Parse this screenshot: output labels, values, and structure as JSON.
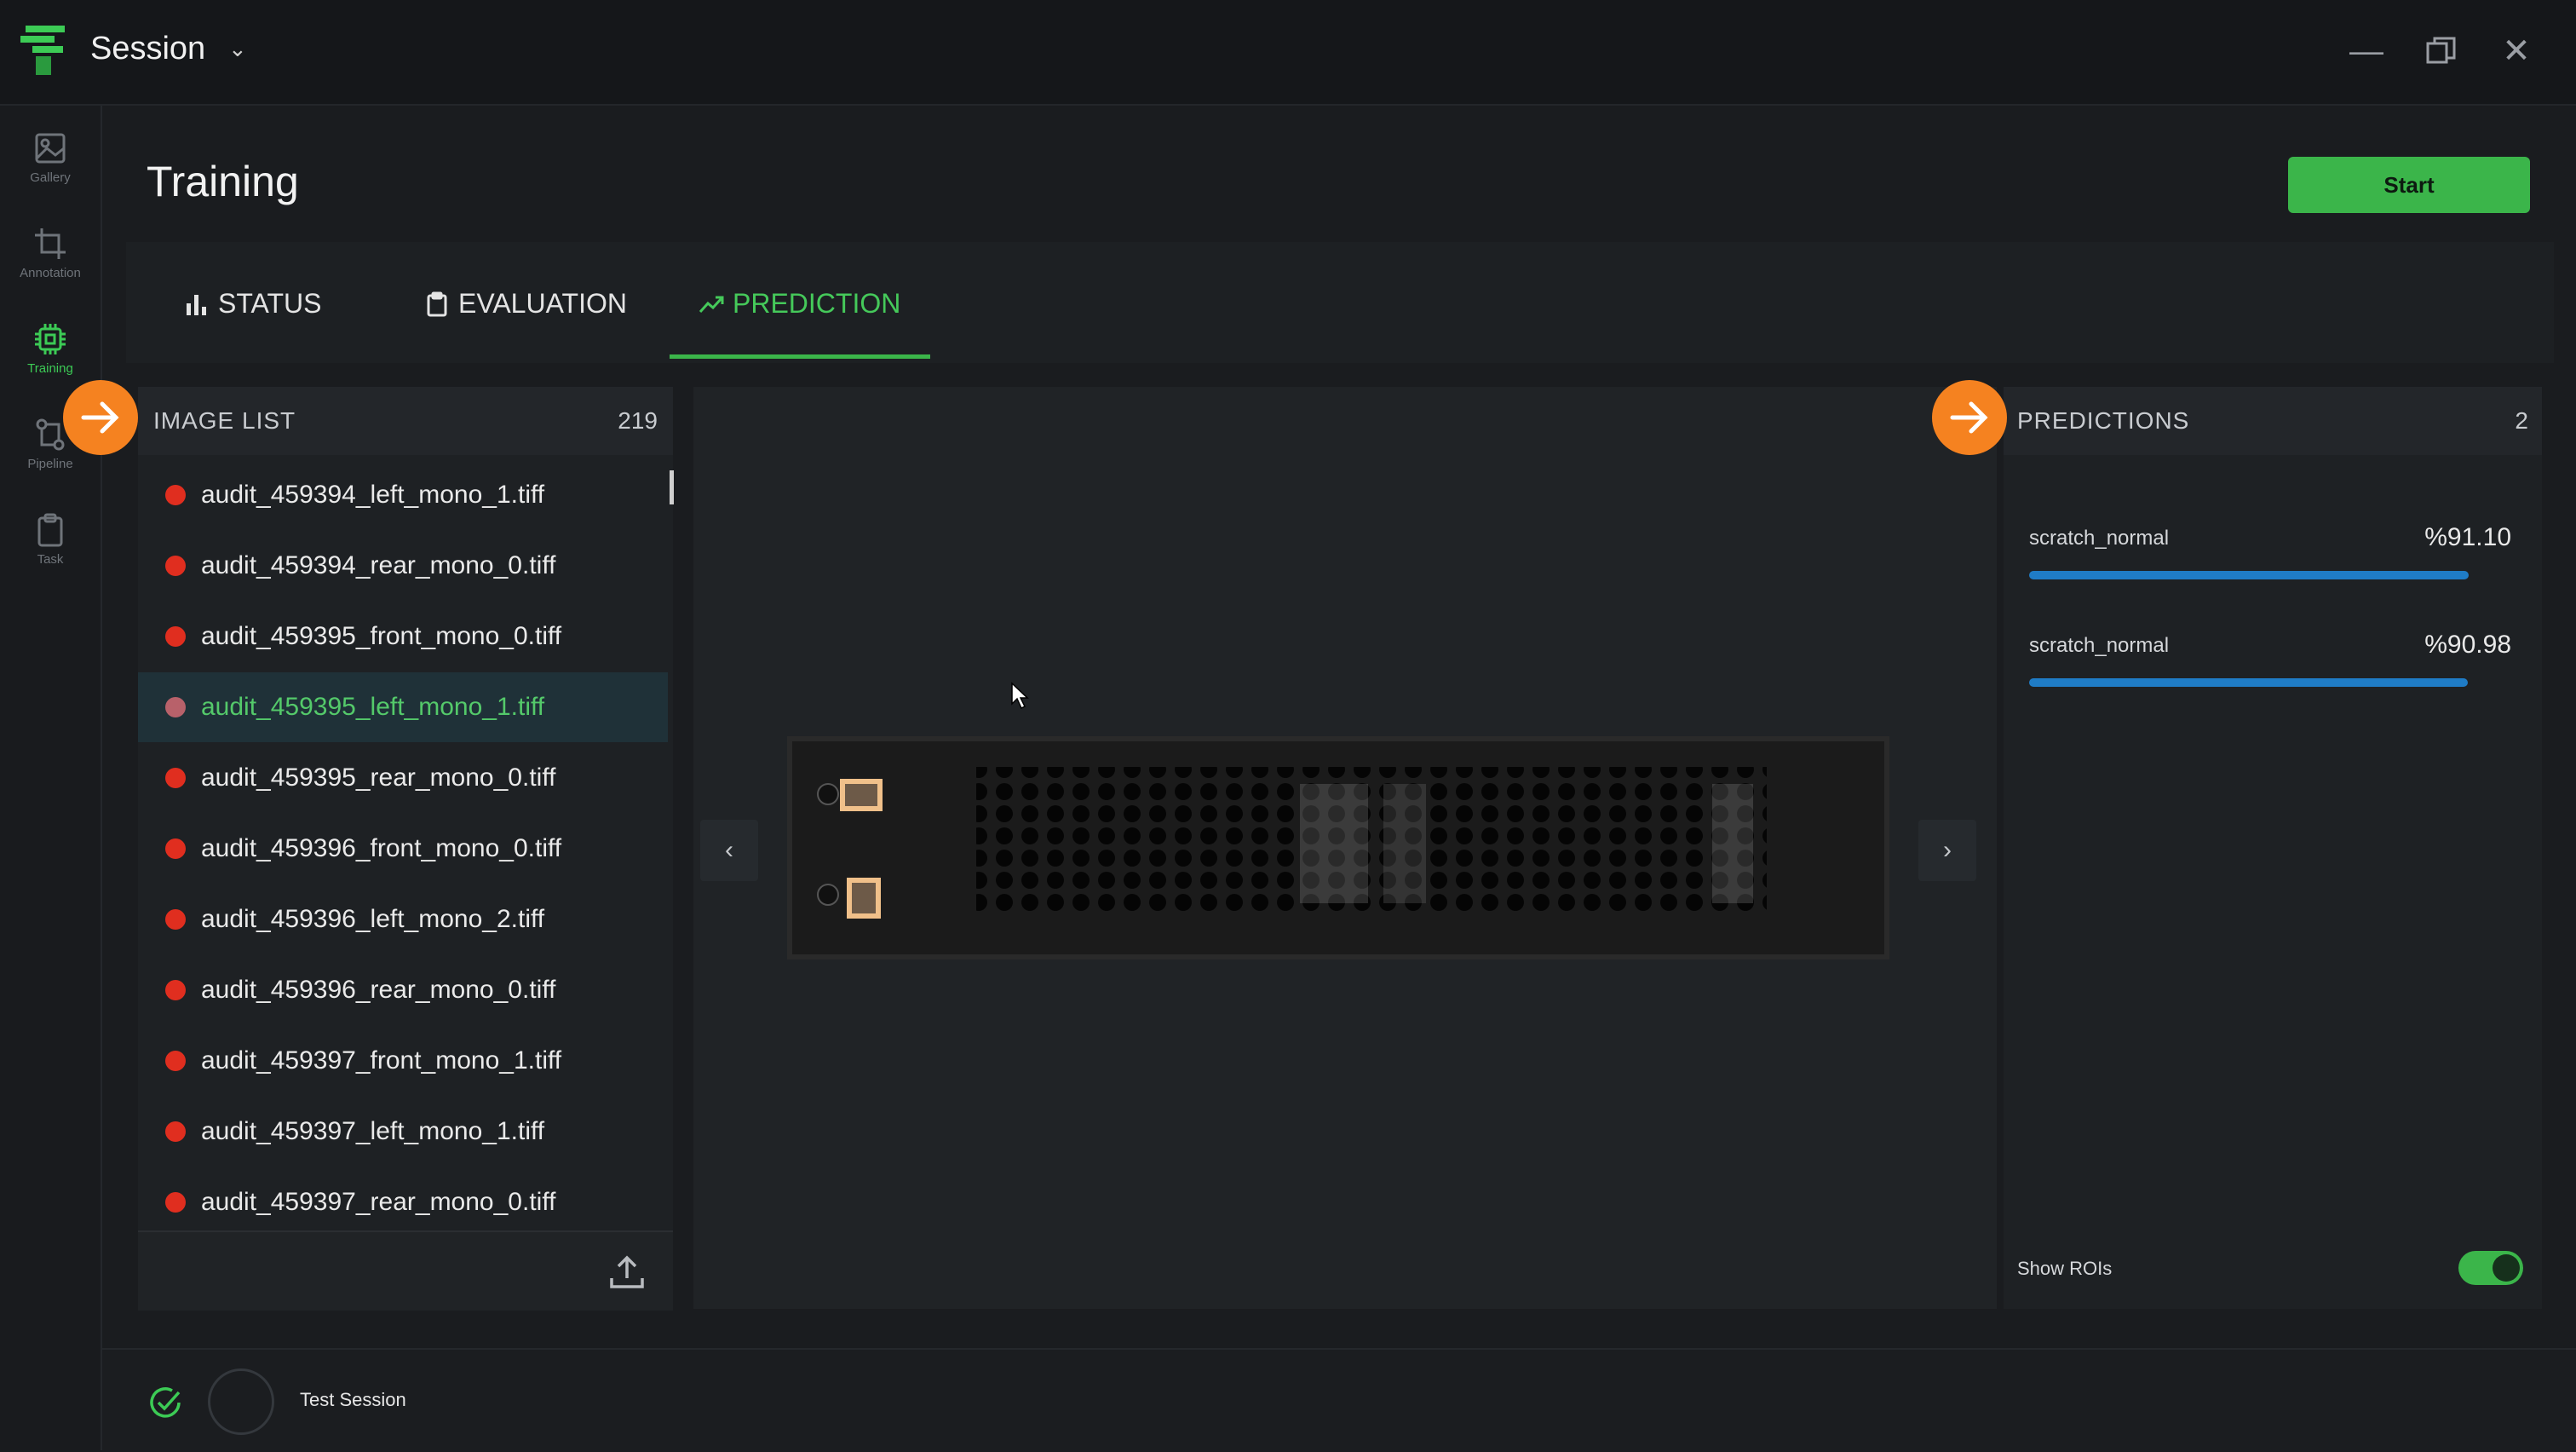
{
  "window": {
    "title": "Session"
  },
  "sidebar": {
    "items": [
      {
        "label": "Gallery",
        "icon": "image-icon"
      },
      {
        "label": "Annotation",
        "icon": "crop-icon"
      },
      {
        "label": "Training",
        "icon": "chip-icon",
        "active": true
      },
      {
        "label": "Pipeline",
        "icon": "pipeline-icon"
      },
      {
        "label": "Task",
        "icon": "clipboard-icon"
      }
    ]
  },
  "page": {
    "title": "Training",
    "start_label": "Start"
  },
  "tabs": [
    {
      "label": "STATUS",
      "icon": "bar-chart-icon"
    },
    {
      "label": "EVALUATION",
      "icon": "clipboard-icon"
    },
    {
      "label": "PREDICTION",
      "icon": "trend-icon",
      "active": true
    }
  ],
  "image_list": {
    "title": "IMAGE LIST",
    "count": "219",
    "items": [
      "audit_459394_left_mono_1.tiff",
      "audit_459394_rear_mono_0.tiff",
      "audit_459395_front_mono_0.tiff",
      "audit_459395_left_mono_1.tiff",
      "audit_459395_rear_mono_0.tiff",
      "audit_459396_front_mono_0.tiff",
      "audit_459396_left_mono_2.tiff",
      "audit_459396_rear_mono_0.tiff",
      "audit_459397_front_mono_1.tiff",
      "audit_459397_left_mono_1.tiff",
      "audit_459397_rear_mono_0.tiff"
    ],
    "selected_index": 3
  },
  "predictions": {
    "title": "PREDICTIONS",
    "count": "2",
    "items": [
      {
        "label": "scratch_normal",
        "percent": "%91.10",
        "value": 0.911
      },
      {
        "label": "scratch_normal",
        "percent": "%90.98",
        "value": 0.9098
      }
    ],
    "show_rois_label": "Show ROIs",
    "show_rois": true
  },
  "status_bar": {
    "session_name": "Test Session"
  },
  "colors": {
    "accent": "#3bb54a",
    "marker": "#f58220",
    "error_dot": "#e02e1f",
    "bar": "#1f7cc6"
  }
}
